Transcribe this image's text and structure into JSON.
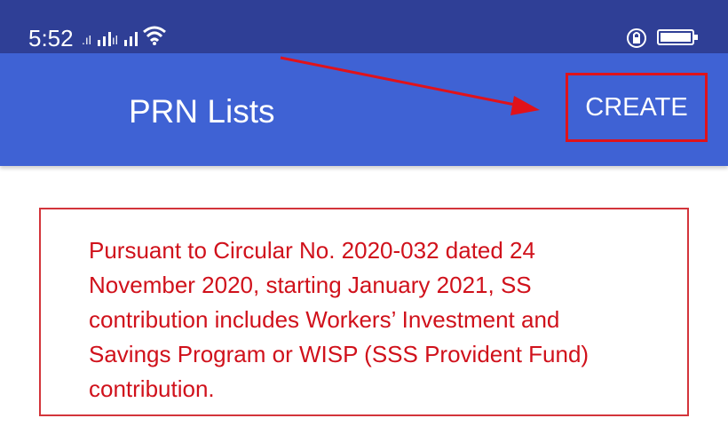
{
  "status_bar": {
    "time": "5:52",
    "icons": [
      "signal-icon",
      "signal-icon",
      "wifi-icon",
      "lock-icon",
      "battery-icon"
    ]
  },
  "app_bar": {
    "title": "PRN Lists",
    "create_label": "CREATE"
  },
  "notice": {
    "text": "Pursuant to Circular No. 2020-032 dated 24\nNovember 2020, starting January 2021, SS\ncontribution includes Workers’ Investment and\nSavings Program or WISP (SSS Provident Fund)\ncontribution."
  },
  "colors": {
    "status_bar": "#2f3f96",
    "app_bar": "#3f62d4",
    "annotation_red": "#e0121a",
    "notice_text": "#d0111b"
  }
}
